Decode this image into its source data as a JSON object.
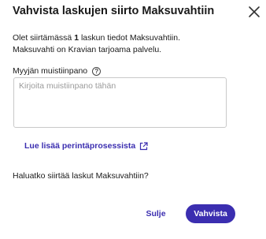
{
  "dialog": {
    "title": "Vahvista laskujen siirto Maksuvahtiin",
    "close_icon": "close-icon",
    "description": {
      "line1_prefix": "Olet siirtämässä ",
      "line1_count": "1",
      "line1_suffix": " laskun tiedot Maksuvahtiin.",
      "line2": "Maksuvahti on Kravian tarjoama palvelu."
    },
    "notes": {
      "label": "Myyjän muistiinpano",
      "help_icon": "help-circle-icon",
      "help_glyph": "?",
      "value": "",
      "placeholder": "Kirjoita muistiinpano tähän"
    },
    "link": {
      "text": "Lue lisää perintäprosessista",
      "icon": "external-link-icon"
    },
    "question": "Haluatko siirtää laskut Maksuvahtiin?",
    "buttons": {
      "cancel": "Sulje",
      "confirm": "Vahvista"
    },
    "colors": {
      "accent": "#3b2eb0",
      "text": "#1a1a1a",
      "placeholder": "#9a9a9a",
      "border": "#c9c9c9"
    }
  }
}
